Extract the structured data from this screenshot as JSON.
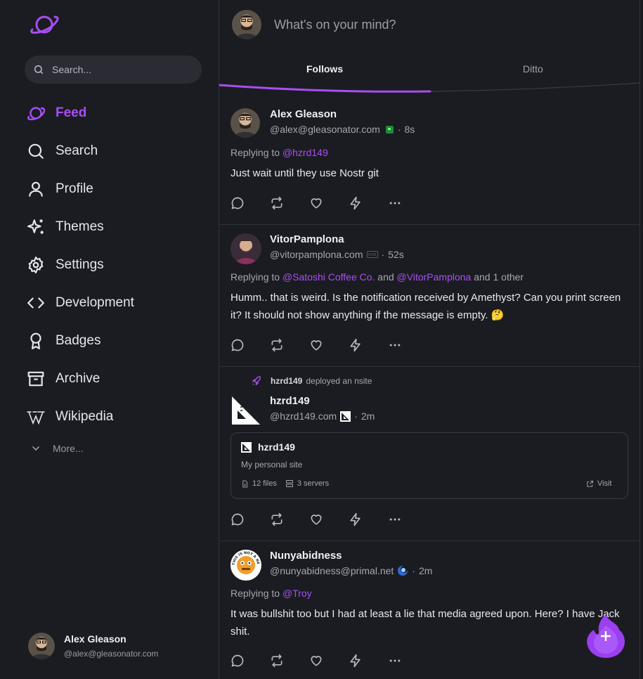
{
  "sidebar": {
    "search_placeholder": "Search...",
    "items": [
      {
        "label": "Feed",
        "icon": "planet-icon",
        "active": true
      },
      {
        "label": "Search",
        "icon": "search-icon"
      },
      {
        "label": "Profile",
        "icon": "user-icon"
      },
      {
        "label": "Themes",
        "icon": "sparkles-icon"
      },
      {
        "label": "Settings",
        "icon": "gear-icon"
      },
      {
        "label": "Development",
        "icon": "code-icon"
      },
      {
        "label": "Badges",
        "icon": "badge-icon"
      },
      {
        "label": "Archive",
        "icon": "archive-icon"
      },
      {
        "label": "Wikipedia",
        "icon": "wikipedia-icon"
      }
    ],
    "more_label": "More...",
    "user": {
      "name": "Alex Gleason",
      "handle": "@alex@gleasonator.com"
    }
  },
  "composer": {
    "placeholder": "What's on your mind?"
  },
  "tabs": [
    {
      "label": "Follows",
      "active": true
    },
    {
      "label": "Ditto"
    }
  ],
  "posts": [
    {
      "name": "Alex Gleason",
      "handle": "@alex@gleasonator.com",
      "time": "8s",
      "replying_prefix": "Replying to",
      "mention1": "@hzrd149",
      "text": "Just wait until they use Nostr git"
    },
    {
      "name": "VitorPamplona",
      "handle": "@vitorpamplona.com",
      "time": "52s",
      "replying_prefix": "Replying to",
      "mention1": "@Satoshi Coffee Co.",
      "and_text": "and",
      "mention2": "@VitorPamplona",
      "others": "and 1 other",
      "text": "Humm.. that is weird. Is the notification received by Amethyst? Can you print screen it? It should not show anything if the message is empty. 🤔"
    },
    {
      "activity_actor": "hzrd149",
      "activity_text": "deployed an nsite",
      "name": "hzrd149",
      "handle": "@hzrd149.com",
      "time": "2m",
      "card": {
        "title": "hzrd149",
        "desc": "My personal site",
        "files": "12 files",
        "servers": "3 servers",
        "visit": "Visit"
      }
    },
    {
      "name": "Nunyabidness",
      "handle": "@nunyabidness@primal.net",
      "time": "2m",
      "replying_prefix": "Replying to",
      "mention1": "@Troy",
      "text": "It was bullshit too but I had at least a lie that media agreed upon. Here? I have Jack shit.",
      "avatar_text": "THIS IS NOT A NEGOTIATION"
    }
  ],
  "colors": {
    "accent": "#a84ef5",
    "background": "#1b1c21",
    "border": "#31323a"
  }
}
